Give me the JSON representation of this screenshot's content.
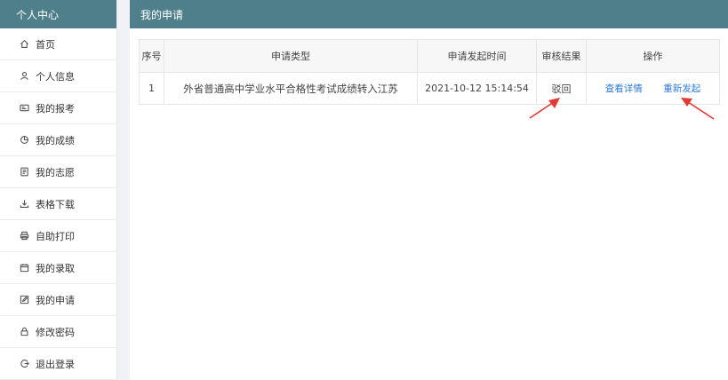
{
  "sidebar": {
    "title": "个人中心",
    "items": [
      {
        "label": "首页",
        "icon": "home-icon"
      },
      {
        "label": "个人信息",
        "icon": "user-icon"
      },
      {
        "label": "我的报考",
        "icon": "id-card-icon"
      },
      {
        "label": "我的成绩",
        "icon": "pie-chart-icon"
      },
      {
        "label": "我的志愿",
        "icon": "document-icon"
      },
      {
        "label": "表格下载",
        "icon": "download-icon"
      },
      {
        "label": "自助打印",
        "icon": "printer-icon"
      },
      {
        "label": "我的录取",
        "icon": "calendar-icon"
      },
      {
        "label": "我的申请",
        "icon": "edit-icon"
      },
      {
        "label": "修改密码",
        "icon": "lock-icon"
      },
      {
        "label": "退出登录",
        "icon": "logout-icon"
      }
    ]
  },
  "main": {
    "title": "我的申请",
    "table": {
      "headers": [
        "序号",
        "申请类型",
        "申请发起时间",
        "审核结果",
        "操作"
      ],
      "rows": [
        {
          "index": "1",
          "type": "外省普通高中学业水平合格性考试成绩转入江苏",
          "time": "2021-10-12 15:14:54",
          "result": "驳回",
          "actions": [
            "查看详情",
            "重新发起"
          ]
        }
      ]
    }
  },
  "colors": {
    "header_bg": "#4e7f8a",
    "link": "#2f7ad8",
    "annotation_arrow": "#e53935"
  }
}
